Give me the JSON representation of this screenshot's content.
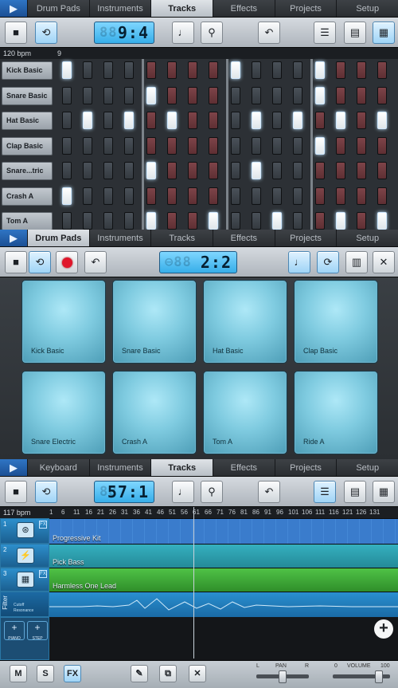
{
  "panel1": {
    "tabs": [
      "▶",
      "Drum Pads",
      "Instruments",
      "Tracks",
      "Effects",
      "Projects",
      "Setup"
    ],
    "active_tab": "Tracks",
    "lcd": "9:4",
    "bpm": "120 bpm",
    "step_marker": "9",
    "rows": [
      "Kick Basic",
      "Snare Basic",
      "Hat Basic",
      "Clap Basic",
      "Snare...tric",
      "Crash A",
      "Tom A"
    ],
    "active_steps": [
      [
        0,
        8,
        12
      ],
      [
        4,
        12
      ],
      [
        1,
        3,
        5,
        9,
        11,
        13,
        15
      ],
      [
        12
      ],
      [
        4,
        9
      ],
      [
        0
      ],
      [
        4,
        7,
        10,
        13,
        15
      ]
    ]
  },
  "panel2": {
    "tabs": [
      "▶",
      "Drum Pads",
      "Instruments",
      "Tracks",
      "Effects",
      "Projects",
      "Setup"
    ],
    "active_tab": "Drum Pads",
    "lcd": "2:2",
    "pads": [
      "Kick Basic",
      "Snare Basic",
      "Hat Basic",
      "Clap Basic",
      "Snare Electric",
      "Crash A",
      "Tom A",
      "Ride A"
    ]
  },
  "panel3": {
    "tabs": [
      "▶",
      "Keyboard",
      "Instruments",
      "Tracks",
      "Effects",
      "Projects",
      "Setup"
    ],
    "active_tab": "Tracks",
    "lcd": "57:1",
    "bpm": "117 bpm",
    "ruler": [
      "1",
      "6",
      "11",
      "16",
      "21",
      "26",
      "31",
      "36",
      "41",
      "46",
      "51",
      "56",
      "61",
      "66",
      "71",
      "76",
      "81",
      "86",
      "91",
      "96",
      "101",
      "106",
      "111",
      "116",
      "121",
      "126",
      "131"
    ],
    "tracks": [
      {
        "num": "1",
        "clip": "Progressive Kit",
        "color": "#3b7fd0",
        "fx": "FX"
      },
      {
        "num": "2",
        "clip": "Pick Bass",
        "color": "#2fa3b3",
        "fx": ""
      },
      {
        "num": "3",
        "clip": "Harmless One Lead",
        "color": "#43b33c",
        "fx": "FX"
      }
    ],
    "filter_label": "Filter",
    "filter_legend": [
      "Cutoff",
      "Resonance"
    ],
    "add_labels": [
      "PIANO",
      "STEP"
    ],
    "bottom": {
      "m": "M",
      "s": "S",
      "fx": "FX",
      "pan_label": "PAN",
      "pan_l": "L",
      "pan_r": "R",
      "vol_label": "VOLUME",
      "vol_min": "0",
      "vol_max": "100",
      "pan_value": 0.5,
      "volume_value": 80
    }
  },
  "colors": {
    "accent": "#36aee9",
    "record": "#e0162b"
  }
}
